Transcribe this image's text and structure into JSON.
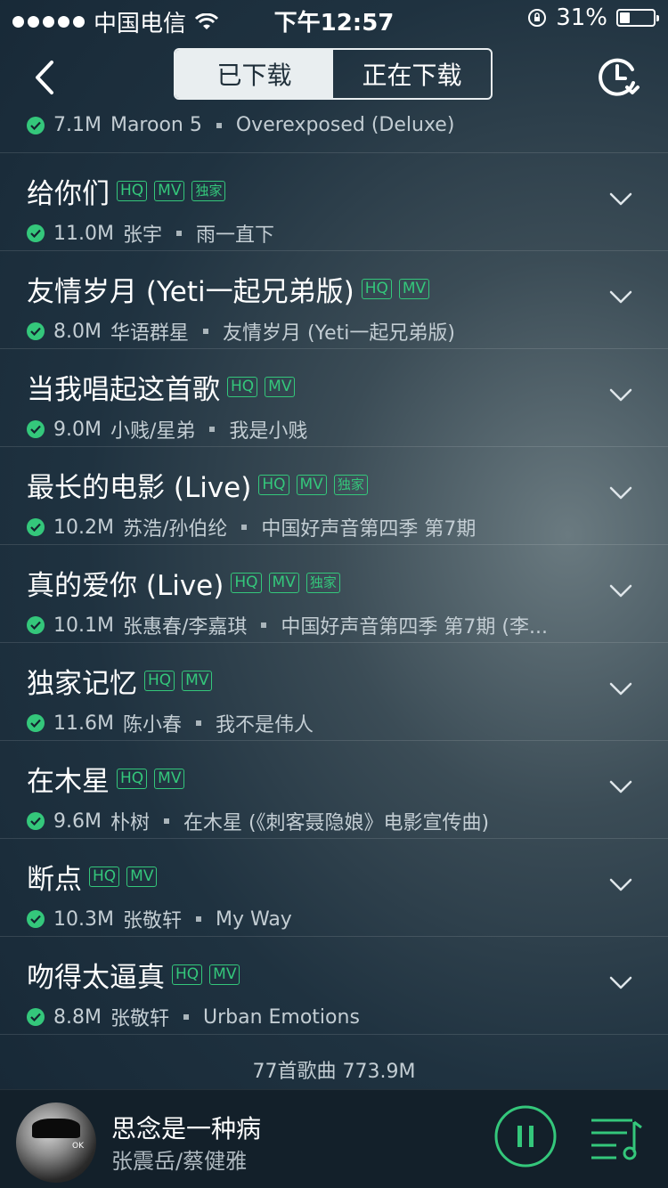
{
  "status_bar": {
    "carrier": "中国电信",
    "time": "下午12:57",
    "battery_text": "31%",
    "battery_level": 0.31
  },
  "nav": {
    "tab_downloaded": "已下载",
    "tab_downloading": "正在下载"
  },
  "partial_row": {
    "size": "7.1M",
    "artist": "Maroon 5",
    "album": "Overexposed (Deluxe)"
  },
  "songs": [
    {
      "title": "给你们",
      "tags": [
        "HQ",
        "MV",
        "独家"
      ],
      "size": "11.0M",
      "artist": "张宇",
      "album": "雨一直下"
    },
    {
      "title": "友情岁月 (Yeti一起兄弟版)",
      "tags": [
        "HQ",
        "MV"
      ],
      "size": "8.0M",
      "artist": "华语群星",
      "album": "友情岁月 (Yeti一起兄弟版)"
    },
    {
      "title": "当我唱起这首歌",
      "tags": [
        "HQ",
        "MV"
      ],
      "size": "9.0M",
      "artist": "小贱/星弟",
      "album": "我是小贱"
    },
    {
      "title": "最长的电影 (Live)",
      "tags": [
        "HQ",
        "MV",
        "独家"
      ],
      "size": "10.2M",
      "artist": "苏浩/孙伯纶",
      "album": "中国好声音第四季 第7期"
    },
    {
      "title": "真的爱你 (Live)",
      "tags": [
        "HQ",
        "MV",
        "独家"
      ],
      "size": "10.1M",
      "artist": "张惠春/李嘉琪",
      "album": "中国好声音第四季 第7期 (李..."
    },
    {
      "title": "独家记忆",
      "tags": [
        "HQ",
        "MV"
      ],
      "size": "11.6M",
      "artist": "陈小春",
      "album": "我不是伟人"
    },
    {
      "title": "在木星",
      "tags": [
        "HQ",
        "MV"
      ],
      "size": "9.6M",
      "artist": "朴树",
      "album": "在木星 (《刺客聂隐娘》电影宣传曲)"
    },
    {
      "title": "断点",
      "tags": [
        "HQ",
        "MV"
      ],
      "size": "10.3M",
      "artist": "张敬轩",
      "album": "My Way"
    },
    {
      "title": "吻得太逼真",
      "tags": [
        "HQ",
        "MV"
      ],
      "size": "8.8M",
      "artist": "张敬轩",
      "album": "Urban Emotions"
    }
  ],
  "summary": "77首歌曲 773.9M",
  "player": {
    "title": "思念是一种病",
    "artist": "张震岳/蔡健雅",
    "album_art_text": "OK",
    "accent": "#34c77b"
  }
}
